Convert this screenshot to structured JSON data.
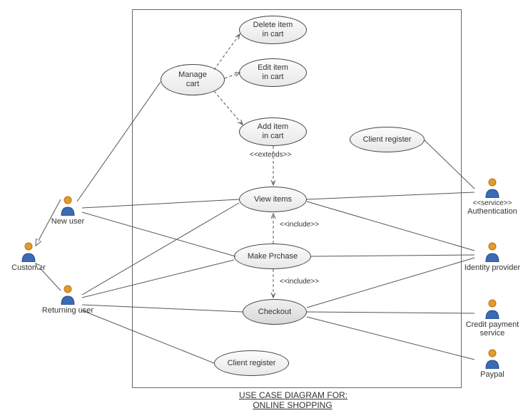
{
  "title_line1": "USE CASE DIAGRAM FOR:",
  "title_line2": "ONLINE SHOPPING",
  "actors": {
    "customer": {
      "label": "Customer"
    },
    "new_user": {
      "label": "New user"
    },
    "returning_user": {
      "label": "Returning user"
    },
    "authentication": {
      "stereotype": "<<service>>",
      "label": "Authentication"
    },
    "identity": {
      "label": "Identity provider"
    },
    "credit": {
      "label": "Credit payment\nservice"
    },
    "paypal": {
      "label": "Paypal"
    }
  },
  "usecases": {
    "manage_cart": "Manage\ncart",
    "delete_item": "Delete item\nin cart",
    "edit_item": "Edit item\nin cart",
    "add_item": "Add item\nin cart",
    "client_reg_top": "Client register",
    "view_items": "View items",
    "make_purchase": "Make Prchase",
    "checkout": "Checkout",
    "client_reg_bot": "Client register"
  },
  "rel_labels": {
    "extends": "<<extends>>",
    "include1": "<<include>>",
    "include2": "<<include>>"
  }
}
